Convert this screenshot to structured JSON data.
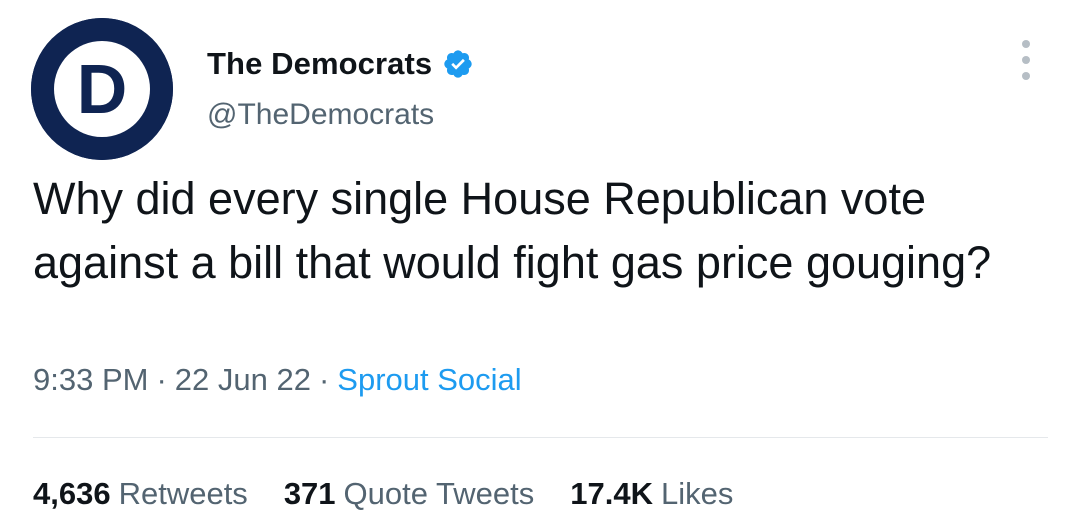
{
  "author": {
    "display_name": "The Democrats",
    "handle": "@TheDemocrats",
    "avatar_letter": "D",
    "avatar_color": "#0f2452",
    "verified_icon": "verified-badge-icon",
    "verified_color": "#1d9bf0"
  },
  "tweet": {
    "text": "Why did every single House Republican vote against a bill that would fight gas price gouging?",
    "time": "9:33 PM",
    "date": "22 Jun 22",
    "separator": "·",
    "source": "Sprout Social"
  },
  "stats": {
    "retweets_count": "4,636",
    "retweets_label": "Retweets",
    "quotes_count": "371",
    "quotes_label": "Quote Tweets",
    "likes_count": "17.4K",
    "likes_label": "Likes"
  },
  "colors": {
    "text_primary": "#0f1419",
    "text_secondary": "#536471",
    "link": "#1d9bf0",
    "divider": "#e5e8eb"
  }
}
